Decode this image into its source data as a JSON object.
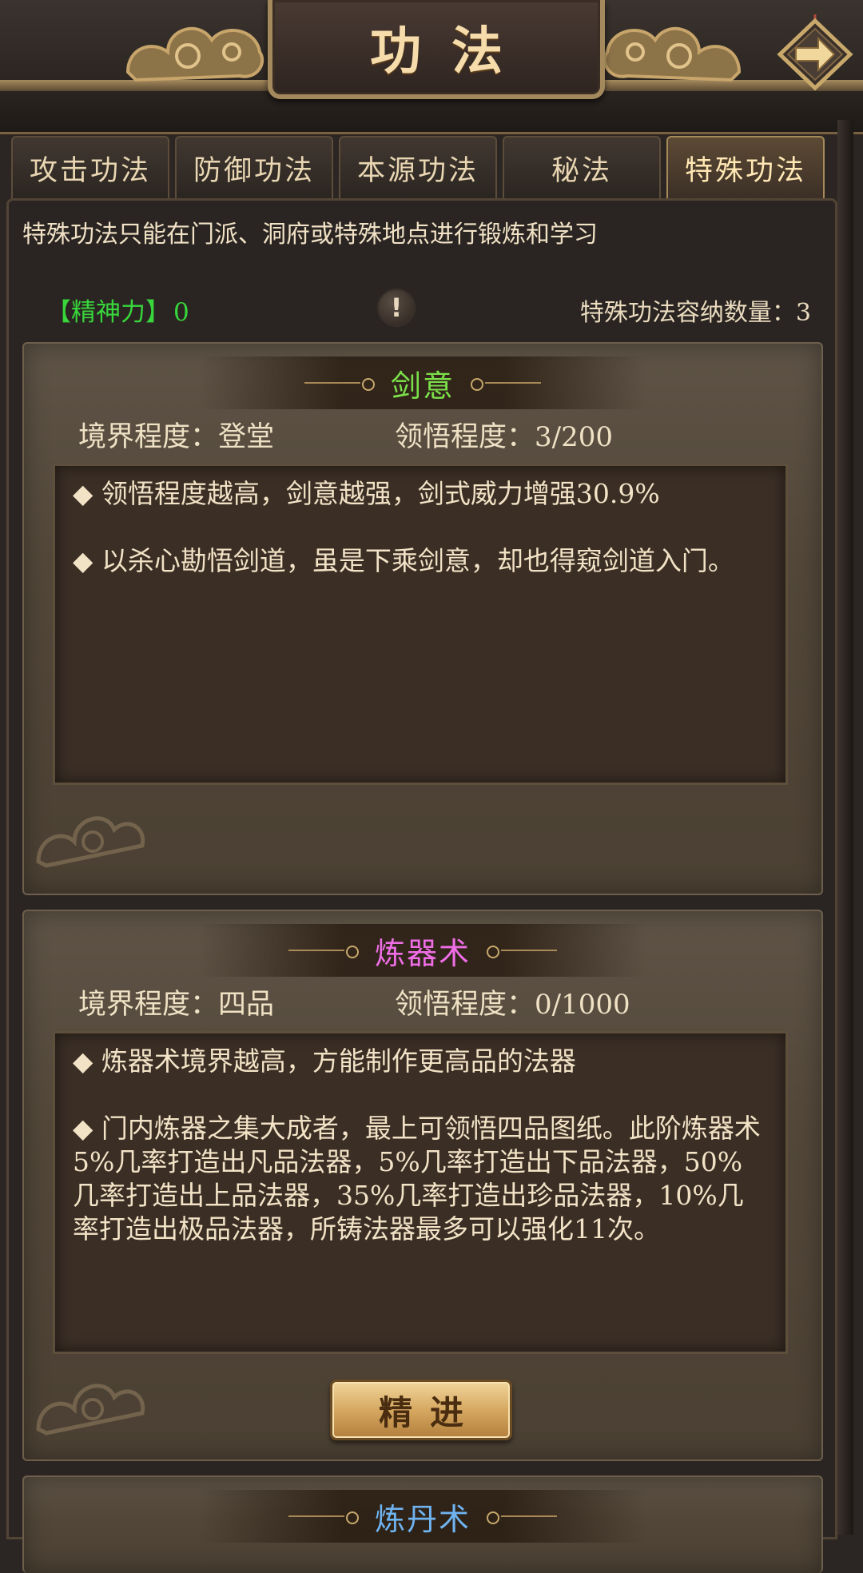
{
  "header": {
    "title": "功法",
    "next_icon": "arrow-right-icon"
  },
  "tabs": [
    {
      "label": "攻击功法",
      "active": false
    },
    {
      "label": "防御功法",
      "active": false
    },
    {
      "label": "本源功法",
      "active": false
    },
    {
      "label": "秘法",
      "active": false
    },
    {
      "label": "特殊功法",
      "active": true
    }
  ],
  "notice": "特殊功法只能在门派、洞府或特殊地点进行锻炼和学习",
  "spirit": {
    "label": "【精神力】",
    "value": "0"
  },
  "capacity": {
    "label": "特殊功法容纳数量：",
    "value": "3"
  },
  "skills": [
    {
      "name": "剑意",
      "name_color": "#7be04a",
      "realm_label": "境界程度：",
      "realm_value": "登堂",
      "comprehension_label": "领悟程度：",
      "comprehension_value": "3/200",
      "lines": [
        "◆ 领悟程度越高，剑意越强，剑式威力增强30.9%",
        "◆ 以杀心勘悟剑道，虽是下乘剑意，却也得窥剑道入门。"
      ]
    },
    {
      "name": "炼器术",
      "name_color": "#ef6ee6",
      "realm_label": "境界程度：",
      "realm_value": "四品",
      "comprehension_label": "领悟程度：",
      "comprehension_value": "0/1000",
      "lines": [
        "◆ 炼器术境界越高，方能制作更高品的法器",
        "◆ 门内炼器之集大成者，最上可领悟四品图纸。此阶炼器术5%几率打造出凡品法器，5%几率打造出下品法器，50%几率打造出上品法器，35%几率打造出珍品法器，10%几率打造出极品法器，所铸法器最多可以强化11次。"
      ],
      "button": "精进"
    },
    {
      "name": "炼丹术",
      "name_color": "#6fb3f0"
    }
  ]
}
